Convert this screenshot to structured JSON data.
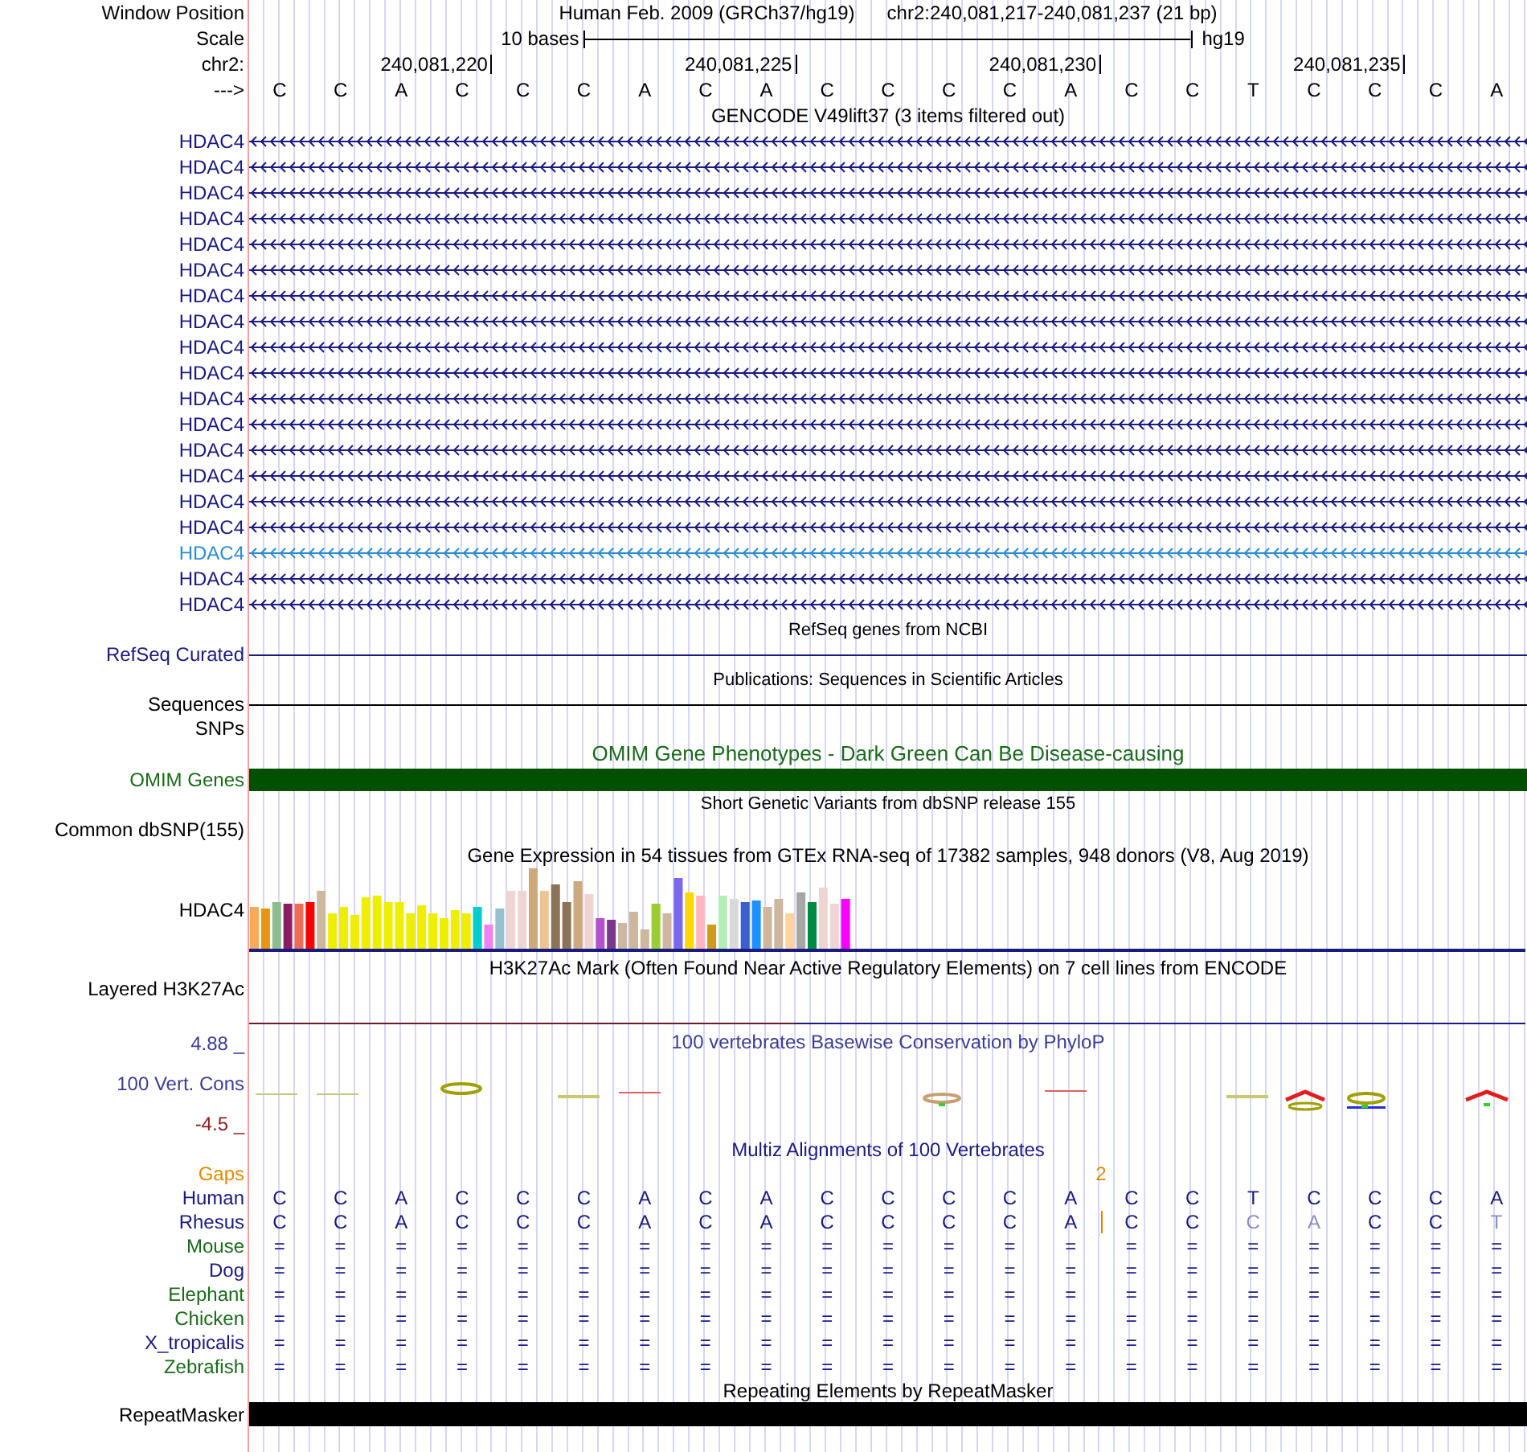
{
  "position": {
    "label": "Window Position",
    "assembly": "Human Feb. 2009 (GRCh37/hg19)",
    "range": "chr2:240,081,217-240,081,237 (21 bp)"
  },
  "scale": {
    "label": "Scale",
    "length": "10 bases",
    "assembly": "hg19"
  },
  "ruler": {
    "label": "chr2:",
    "ticks": [
      "240,081,220",
      "240,081,225",
      "240,081,230",
      "240,081,235"
    ]
  },
  "sequence": {
    "label": "--->",
    "bases": [
      "C",
      "C",
      "A",
      "C",
      "C",
      "C",
      "A",
      "C",
      "A",
      "C",
      "C",
      "C",
      "C",
      "A",
      "C",
      "C",
      "T",
      "C",
      "C",
      "C",
      "A"
    ]
  },
  "gencode": {
    "title": "GENCODE V49lift37 (3 items filtered out)",
    "genes": [
      {
        "name": "HDAC4",
        "highlighted": false
      },
      {
        "name": "HDAC4",
        "highlighted": false
      },
      {
        "name": "HDAC4",
        "highlighted": false
      },
      {
        "name": "HDAC4",
        "highlighted": false
      },
      {
        "name": "HDAC4",
        "highlighted": false
      },
      {
        "name": "HDAC4",
        "highlighted": false
      },
      {
        "name": "HDAC4",
        "highlighted": false
      },
      {
        "name": "HDAC4",
        "highlighted": false
      },
      {
        "name": "HDAC4",
        "highlighted": false
      },
      {
        "name": "HDAC4",
        "highlighted": false
      },
      {
        "name": "HDAC4",
        "highlighted": false
      },
      {
        "name": "HDAC4",
        "highlighted": false
      },
      {
        "name": "HDAC4",
        "highlighted": false
      },
      {
        "name": "HDAC4",
        "highlighted": false
      },
      {
        "name": "HDAC4",
        "highlighted": false
      },
      {
        "name": "HDAC4",
        "highlighted": false
      },
      {
        "name": "HDAC4",
        "highlighted": true
      },
      {
        "name": "HDAC4",
        "highlighted": false
      },
      {
        "name": "HDAC4",
        "highlighted": false
      }
    ]
  },
  "refseq": {
    "title": "RefSeq genes from NCBI",
    "label": "RefSeq Curated"
  },
  "publications": {
    "title": "Publications: Sequences in Scientific Articles",
    "sequences_label": "Sequences",
    "snps_label": "SNPs"
  },
  "omim": {
    "title": "OMIM Gene Phenotypes - Dark Green Can Be Disease-causing",
    "label": "OMIM Genes"
  },
  "dbsnp": {
    "title": "Short Genetic Variants from dbSNP release 155",
    "label": "Common dbSNP(155)"
  },
  "gtex": {
    "title": "Gene Expression in 54 tissues from GTEx RNA-seq of 17382 samples, 948 donors (V8, Aug 2019)",
    "label": "HDAC4"
  },
  "h3k27ac": {
    "title": "H3K27Ac Mark (Often Found Near Active Regulatory Elements) on 7 cell lines from ENCODE",
    "label": "Layered H3K27Ac"
  },
  "phylop": {
    "title": "100 vertebrates Basewise Conservation by PhyloP",
    "label": "100 Vert. Cons",
    "max": "4.88 _",
    "min": "-4.5 _"
  },
  "multiz": {
    "title": "Multiz Alignments of 100 Vertebrates",
    "gaps": {
      "label": "Gaps",
      "count": "2"
    },
    "species": [
      {
        "name": "Human",
        "color": "#1a1a80",
        "bases": [
          {
            "base": "C",
            "match": true,
            "insertion_after": false
          },
          {
            "base": "C",
            "match": true,
            "insertion_after": false
          },
          {
            "base": "A",
            "match": true,
            "insertion_after": false
          },
          {
            "base": "C",
            "match": true,
            "insertion_after": false
          },
          {
            "base": "C",
            "match": true,
            "insertion_after": false
          },
          {
            "base": "C",
            "match": true,
            "insertion_after": false
          },
          {
            "base": "A",
            "match": true,
            "insertion_after": false
          },
          {
            "base": "C",
            "match": true,
            "insertion_after": false
          },
          {
            "base": "A",
            "match": true,
            "insertion_after": false
          },
          {
            "base": "C",
            "match": true,
            "insertion_after": false
          },
          {
            "base": "C",
            "match": true,
            "insertion_after": false
          },
          {
            "base": "C",
            "match": true,
            "insertion_after": false
          },
          {
            "base": "C",
            "match": true,
            "insertion_after": false
          },
          {
            "base": "A",
            "match": true,
            "insertion_after": false
          },
          {
            "base": "C",
            "match": true,
            "insertion_after": false
          },
          {
            "base": "C",
            "match": true,
            "insertion_after": false
          },
          {
            "base": "T",
            "match": true,
            "insertion_after": false
          },
          {
            "base": "C",
            "match": true,
            "insertion_after": false
          },
          {
            "base": "C",
            "match": true,
            "insertion_after": false
          },
          {
            "base": "C",
            "match": true,
            "insertion_after": false
          },
          {
            "base": "A",
            "match": true,
            "insertion_after": false
          }
        ]
      },
      {
        "name": "Rhesus",
        "color": "#1a1a80",
        "bases": [
          {
            "base": "C",
            "match": true,
            "insertion_after": false
          },
          {
            "base": "C",
            "match": true,
            "insertion_after": false
          },
          {
            "base": "A",
            "match": true,
            "insertion_after": false
          },
          {
            "base": "C",
            "match": true,
            "insertion_after": false
          },
          {
            "base": "C",
            "match": true,
            "insertion_after": false
          },
          {
            "base": "C",
            "match": true,
            "insertion_after": false
          },
          {
            "base": "A",
            "match": true,
            "insertion_after": false
          },
          {
            "base": "C",
            "match": true,
            "insertion_after": false
          },
          {
            "base": "A",
            "match": true,
            "insertion_after": false
          },
          {
            "base": "C",
            "match": true,
            "insertion_after": false
          },
          {
            "base": "C",
            "match": true,
            "insertion_after": false
          },
          {
            "base": "C",
            "match": true,
            "insertion_after": false
          },
          {
            "base": "C",
            "match": true,
            "insertion_after": false
          },
          {
            "base": "A",
            "match": true,
            "insertion_after": true
          },
          {
            "base": "C",
            "match": true,
            "insertion_after": false
          },
          {
            "base": "C",
            "match": true,
            "insertion_after": false
          },
          {
            "base": "C",
            "match": false,
            "insertion_after": false
          },
          {
            "base": "A",
            "match": false,
            "insertion_after": false
          },
          {
            "base": "C",
            "match": true,
            "insertion_after": false
          },
          {
            "base": "C",
            "match": true,
            "insertion_after": false
          },
          {
            "base": "T",
            "match": false,
            "insertion_after": false
          }
        ]
      },
      {
        "name": "Mouse",
        "color": "#1a6b1a",
        "bases": [
          {
            "base": "=",
            "match": true,
            "insertion_after": false
          },
          {
            "base": "=",
            "match": true,
            "insertion_after": false
          },
          {
            "base": "=",
            "match": true,
            "insertion_after": false
          },
          {
            "base": "=",
            "match": true,
            "insertion_after": false
          },
          {
            "base": "=",
            "match": true,
            "insertion_after": false
          },
          {
            "base": "=",
            "match": true,
            "insertion_after": false
          },
          {
            "base": "=",
            "match": true,
            "insertion_after": false
          },
          {
            "base": "=",
            "match": true,
            "insertion_after": false
          },
          {
            "base": "=",
            "match": true,
            "insertion_after": false
          },
          {
            "base": "=",
            "match": true,
            "insertion_after": false
          },
          {
            "base": "=",
            "match": true,
            "insertion_after": false
          },
          {
            "base": "=",
            "match": true,
            "insertion_after": false
          },
          {
            "base": "=",
            "match": true,
            "insertion_after": false
          },
          {
            "base": "=",
            "match": true,
            "insertion_after": false
          },
          {
            "base": "=",
            "match": true,
            "insertion_after": false
          },
          {
            "base": "=",
            "match": true,
            "insertion_after": false
          },
          {
            "base": "=",
            "match": true,
            "insertion_after": false
          },
          {
            "base": "=",
            "match": true,
            "insertion_after": false
          },
          {
            "base": "=",
            "match": true,
            "insertion_after": false
          },
          {
            "base": "=",
            "match": true,
            "insertion_after": false
          },
          {
            "base": "=",
            "match": true,
            "insertion_after": false
          }
        ]
      },
      {
        "name": "Dog",
        "color": "#1a1a80",
        "bases": [
          {
            "base": "=",
            "match": true,
            "insertion_after": false
          },
          {
            "base": "=",
            "match": true,
            "insertion_after": false
          },
          {
            "base": "=",
            "match": true,
            "insertion_after": false
          },
          {
            "base": "=",
            "match": true,
            "insertion_after": false
          },
          {
            "base": "=",
            "match": true,
            "insertion_after": false
          },
          {
            "base": "=",
            "match": true,
            "insertion_after": false
          },
          {
            "base": "=",
            "match": true,
            "insertion_after": false
          },
          {
            "base": "=",
            "match": true,
            "insertion_after": false
          },
          {
            "base": "=",
            "match": true,
            "insertion_after": false
          },
          {
            "base": "=",
            "match": true,
            "insertion_after": false
          },
          {
            "base": "=",
            "match": true,
            "insertion_after": false
          },
          {
            "base": "=",
            "match": true,
            "insertion_after": false
          },
          {
            "base": "=",
            "match": true,
            "insertion_after": false
          },
          {
            "base": "=",
            "match": true,
            "insertion_after": false
          },
          {
            "base": "=",
            "match": true,
            "insertion_after": false
          },
          {
            "base": "=",
            "match": true,
            "insertion_after": false
          },
          {
            "base": "=",
            "match": true,
            "insertion_after": false
          },
          {
            "base": "=",
            "match": true,
            "insertion_after": false
          },
          {
            "base": "=",
            "match": true,
            "insertion_after": false
          },
          {
            "base": "=",
            "match": true,
            "insertion_after": false
          },
          {
            "base": "=",
            "match": true,
            "insertion_after": false
          }
        ]
      },
      {
        "name": "Elephant",
        "color": "#1a6b1a",
        "bases": [
          {
            "base": "=",
            "match": true,
            "insertion_after": false
          },
          {
            "base": "=",
            "match": true,
            "insertion_after": false
          },
          {
            "base": "=",
            "match": true,
            "insertion_after": false
          },
          {
            "base": "=",
            "match": true,
            "insertion_after": false
          },
          {
            "base": "=",
            "match": true,
            "insertion_after": false
          },
          {
            "base": "=",
            "match": true,
            "insertion_after": false
          },
          {
            "base": "=",
            "match": true,
            "insertion_after": false
          },
          {
            "base": "=",
            "match": true,
            "insertion_after": false
          },
          {
            "base": "=",
            "match": true,
            "insertion_after": false
          },
          {
            "base": "=",
            "match": true,
            "insertion_after": false
          },
          {
            "base": "=",
            "match": true,
            "insertion_after": false
          },
          {
            "base": "=",
            "match": true,
            "insertion_after": false
          },
          {
            "base": "=",
            "match": true,
            "insertion_after": false
          },
          {
            "base": "=",
            "match": true,
            "insertion_after": false
          },
          {
            "base": "=",
            "match": true,
            "insertion_after": false
          },
          {
            "base": "=",
            "match": true,
            "insertion_after": false
          },
          {
            "base": "=",
            "match": true,
            "insertion_after": false
          },
          {
            "base": "=",
            "match": true,
            "insertion_after": false
          },
          {
            "base": "=",
            "match": true,
            "insertion_after": false
          },
          {
            "base": "=",
            "match": true,
            "insertion_after": false
          },
          {
            "base": "=",
            "match": true,
            "insertion_after": false
          }
        ]
      },
      {
        "name": "Chicken",
        "color": "#1a6b1a",
        "bases": [
          {
            "base": "=",
            "match": true,
            "insertion_after": false
          },
          {
            "base": "=",
            "match": true,
            "insertion_after": false
          },
          {
            "base": "=",
            "match": true,
            "insertion_after": false
          },
          {
            "base": "=",
            "match": true,
            "insertion_after": false
          },
          {
            "base": "=",
            "match": true,
            "insertion_after": false
          },
          {
            "base": "=",
            "match": true,
            "insertion_after": false
          },
          {
            "base": "=",
            "match": true,
            "insertion_after": false
          },
          {
            "base": "=",
            "match": true,
            "insertion_after": false
          },
          {
            "base": "=",
            "match": true,
            "insertion_after": false
          },
          {
            "base": "=",
            "match": true,
            "insertion_after": false
          },
          {
            "base": "=",
            "match": true,
            "insertion_after": false
          },
          {
            "base": "=",
            "match": true,
            "insertion_after": false
          },
          {
            "base": "=",
            "match": true,
            "insertion_after": false
          },
          {
            "base": "=",
            "match": true,
            "insertion_after": false
          },
          {
            "base": "=",
            "match": true,
            "insertion_after": false
          },
          {
            "base": "=",
            "match": true,
            "insertion_after": false
          },
          {
            "base": "=",
            "match": true,
            "insertion_after": false
          },
          {
            "base": "=",
            "match": true,
            "insertion_after": false
          },
          {
            "base": "=",
            "match": true,
            "insertion_after": false
          },
          {
            "base": "=",
            "match": true,
            "insertion_after": false
          },
          {
            "base": "=",
            "match": true,
            "insertion_after": false
          }
        ]
      },
      {
        "name": "X_tropicalis",
        "color": "#1a1a80",
        "bases": [
          {
            "base": "=",
            "match": true,
            "insertion_after": false
          },
          {
            "base": "=",
            "match": true,
            "insertion_after": false
          },
          {
            "base": "=",
            "match": true,
            "insertion_after": false
          },
          {
            "base": "=",
            "match": true,
            "insertion_after": false
          },
          {
            "base": "=",
            "match": true,
            "insertion_after": false
          },
          {
            "base": "=",
            "match": true,
            "insertion_after": false
          },
          {
            "base": "=",
            "match": true,
            "insertion_after": false
          },
          {
            "base": "=",
            "match": true,
            "insertion_after": false
          },
          {
            "base": "=",
            "match": true,
            "insertion_after": false
          },
          {
            "base": "=",
            "match": true,
            "insertion_after": false
          },
          {
            "base": "=",
            "match": true,
            "insertion_after": false
          },
          {
            "base": "=",
            "match": true,
            "insertion_after": false
          },
          {
            "base": "=",
            "match": true,
            "insertion_after": false
          },
          {
            "base": "=",
            "match": true,
            "insertion_after": false
          },
          {
            "base": "=",
            "match": true,
            "insertion_after": false
          },
          {
            "base": "=",
            "match": true,
            "insertion_after": false
          },
          {
            "base": "=",
            "match": true,
            "insertion_after": false
          },
          {
            "base": "=",
            "match": true,
            "insertion_after": false
          },
          {
            "base": "=",
            "match": true,
            "insertion_after": false
          },
          {
            "base": "=",
            "match": true,
            "insertion_after": false
          },
          {
            "base": "=",
            "match": true,
            "insertion_after": false
          }
        ]
      },
      {
        "name": "Zebrafish",
        "color": "#1a6b1a",
        "bases": [
          {
            "base": "=",
            "match": true,
            "insertion_after": false
          },
          {
            "base": "=",
            "match": true,
            "insertion_after": false
          },
          {
            "base": "=",
            "match": true,
            "insertion_after": false
          },
          {
            "base": "=",
            "match": true,
            "insertion_after": false
          },
          {
            "base": "=",
            "match": true,
            "insertion_after": false
          },
          {
            "base": "=",
            "match": true,
            "insertion_after": false
          },
          {
            "base": "=",
            "match": true,
            "insertion_after": false
          },
          {
            "base": "=",
            "match": true,
            "insertion_after": false
          },
          {
            "base": "=",
            "match": true,
            "insertion_after": false
          },
          {
            "base": "=",
            "match": true,
            "insertion_after": false
          },
          {
            "base": "=",
            "match": true,
            "insertion_after": false
          },
          {
            "base": "=",
            "match": true,
            "insertion_after": false
          },
          {
            "base": "=",
            "match": true,
            "insertion_after": false
          },
          {
            "base": "=",
            "match": true,
            "insertion_after": false
          },
          {
            "base": "=",
            "match": true,
            "insertion_after": false
          },
          {
            "base": "=",
            "match": true,
            "insertion_after": false
          },
          {
            "base": "=",
            "match": true,
            "insertion_after": false
          },
          {
            "base": "=",
            "match": true,
            "insertion_after": false
          },
          {
            "base": "=",
            "match": true,
            "insertion_after": false
          },
          {
            "base": "=",
            "match": true,
            "insertion_after": false
          },
          {
            "base": "=",
            "match": true,
            "insertion_after": false
          }
        ]
      }
    ]
  },
  "repeatmasker": {
    "title": "Repeating Elements by RepeatMasker",
    "label": "RepeatMasker"
  }
}
